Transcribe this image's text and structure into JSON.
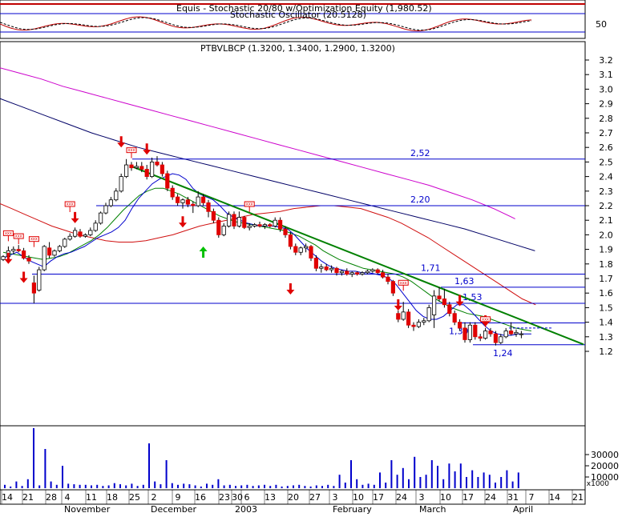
{
  "chart_data": {
    "type": "candlestick",
    "colors": {
      "up": "#ffffff",
      "down": "#e00000",
      "ma_short": "#0000cc",
      "ma_mid": "#008000",
      "ma_long_red": "#d01010",
      "ma_long_navy": "#000066",
      "ma_long_magenta": "#cc00cc",
      "trendline": "#008000",
      "level": "#0000cc",
      "volume": "#0000cc",
      "signal": "#e00000",
      "signal_up": "#00c000"
    },
    "indicator_panel": {
      "title": "Equis - Stochastic 20/80  w/Optimization Equity (1,980.52)",
      "subtitle": "Stochastic Oscillator (20.5128)",
      "ytick": "50"
    },
    "price_panel": {
      "title": "PTBVLBCP (1.3200, 1.3400, 1.2900, 1.3200)",
      "yticks": [
        "3.2",
        "3.1",
        "3.0",
        "2.9",
        "2.8",
        "2.7",
        "2.6",
        "2.5",
        "2.4",
        "2.3",
        "2.2",
        "2.1",
        "2.0",
        "1.9",
        "1.8",
        "1.7",
        "1.6",
        "1.5",
        "1.4",
        "1.3",
        "1.2"
      ],
      "levels": [
        {
          "label": "2,52",
          "value": 2.52
        },
        {
          "label": "2,20",
          "value": 2.2
        },
        {
          "label": "1,71",
          "value": 1.73
        },
        {
          "label": "1,63",
          "value": 1.64
        },
        {
          "label": "1,53",
          "value": 1.53
        },
        {
          "label": "1,39",
          "value": 1.395
        },
        {
          "label": "1,24",
          "value": 1.245
        }
      ],
      "candles": [
        {
          "o": 1.83,
          "h": 1.86,
          "l": 1.82,
          "c": 1.85
        },
        {
          "o": 1.85,
          "h": 1.92,
          "l": 1.84,
          "c": 1.89
        },
        {
          "o": 1.89,
          "h": 1.92,
          "l": 1.87,
          "c": 1.9
        },
        {
          "o": 1.9,
          "h": 1.93,
          "l": 1.88,
          "c": 1.89
        },
        {
          "o": 1.89,
          "h": 1.91,
          "l": 1.83,
          "c": 1.84
        },
        {
          "o": 1.84,
          "h": 1.86,
          "l": 1.8,
          "c": 1.82
        },
        {
          "o": 1.67,
          "h": 1.72,
          "l": 1.53,
          "c": 1.6
        },
        {
          "o": 1.62,
          "h": 1.78,
          "l": 1.61,
          "c": 1.76
        },
        {
          "o": 1.76,
          "h": 1.93,
          "l": 1.75,
          "c": 1.92
        },
        {
          "o": 1.91,
          "h": 1.95,
          "l": 1.84,
          "c": 1.86
        },
        {
          "o": 1.86,
          "h": 1.9,
          "l": 1.85,
          "c": 1.89
        },
        {
          "o": 1.89,
          "h": 1.93,
          "l": 1.88,
          "c": 1.92
        },
        {
          "o": 1.92,
          "h": 1.98,
          "l": 1.91,
          "c": 1.97
        },
        {
          "o": 1.97,
          "h": 2.01,
          "l": 1.96,
          "c": 1.99
        },
        {
          "o": 1.99,
          "h": 2.05,
          "l": 1.98,
          "c": 2.03
        },
        {
          "o": 2.02,
          "h": 2.04,
          "l": 1.98,
          "c": 1.99
        },
        {
          "o": 1.99,
          "h": 2.01,
          "l": 1.98,
          "c": 2.0
        },
        {
          "o": 2.0,
          "h": 2.05,
          "l": 1.99,
          "c": 2.03
        },
        {
          "o": 2.03,
          "h": 2.1,
          "l": 2.02,
          "c": 2.08
        },
        {
          "o": 2.08,
          "h": 2.16,
          "l": 2.07,
          "c": 2.15
        },
        {
          "o": 2.15,
          "h": 2.22,
          "l": 2.14,
          "c": 2.2
        },
        {
          "o": 2.2,
          "h": 2.26,
          "l": 2.19,
          "c": 2.24
        },
        {
          "o": 2.24,
          "h": 2.32,
          "l": 2.23,
          "c": 2.3
        },
        {
          "o": 2.3,
          "h": 2.42,
          "l": 2.29,
          "c": 2.4
        },
        {
          "o": 2.4,
          "h": 2.52,
          "l": 2.39,
          "c": 2.48
        },
        {
          "o": 2.48,
          "h": 2.5,
          "l": 2.44,
          "c": 2.46
        },
        {
          "o": 2.46,
          "h": 2.5,
          "l": 2.45,
          "c": 2.47
        },
        {
          "o": 2.47,
          "h": 2.5,
          "l": 2.43,
          "c": 2.45
        },
        {
          "o": 2.45,
          "h": 2.48,
          "l": 2.38,
          "c": 2.4
        },
        {
          "o": 2.4,
          "h": 2.53,
          "l": 2.39,
          "c": 2.5
        },
        {
          "o": 2.5,
          "h": 2.54,
          "l": 2.47,
          "c": 2.48
        },
        {
          "o": 2.48,
          "h": 2.5,
          "l": 2.4,
          "c": 2.42
        },
        {
          "o": 2.42,
          "h": 2.44,
          "l": 2.3,
          "c": 2.32
        },
        {
          "o": 2.32,
          "h": 2.34,
          "l": 2.24,
          "c": 2.26
        },
        {
          "o": 2.26,
          "h": 2.28,
          "l": 2.2,
          "c": 2.22
        },
        {
          "o": 2.22,
          "h": 2.25,
          "l": 2.18,
          "c": 2.24
        },
        {
          "o": 2.24,
          "h": 2.26,
          "l": 2.19,
          "c": 2.21
        },
        {
          "o": 2.21,
          "h": 2.23,
          "l": 2.15,
          "c": 2.2
        },
        {
          "o": 2.2,
          "h": 2.3,
          "l": 2.19,
          "c": 2.26
        },
        {
          "o": 2.26,
          "h": 2.28,
          "l": 2.2,
          "c": 2.22
        },
        {
          "o": 2.22,
          "h": 2.24,
          "l": 2.12,
          "c": 2.16
        },
        {
          "o": 2.16,
          "h": 2.18,
          "l": 2.08,
          "c": 2.1
        },
        {
          "o": 2.1,
          "h": 2.12,
          "l": 1.98,
          "c": 2.0
        },
        {
          "o": 2.0,
          "h": 2.08,
          "l": 1.99,
          "c": 2.06
        },
        {
          "o": 2.06,
          "h": 2.16,
          "l": 2.05,
          "c": 2.14
        },
        {
          "o": 2.14,
          "h": 2.16,
          "l": 2.04,
          "c": 2.06
        },
        {
          "o": 2.06,
          "h": 2.16,
          "l": 2.05,
          "c": 2.12
        },
        {
          "o": 2.12,
          "h": 2.13,
          "l": 2.04,
          "c": 2.05
        },
        {
          "o": 2.05,
          "h": 2.08,
          "l": 2.03,
          "c": 2.06
        },
        {
          "o": 2.06,
          "h": 2.08,
          "l": 2.05,
          "c": 2.07
        },
        {
          "o": 2.07,
          "h": 2.09,
          "l": 2.05,
          "c": 2.06
        },
        {
          "o": 2.06,
          "h": 2.08,
          "l": 2.04,
          "c": 2.07
        },
        {
          "o": 2.07,
          "h": 2.08,
          "l": 2.05,
          "c": 2.06
        },
        {
          "o": 2.06,
          "h": 2.12,
          "l": 2.05,
          "c": 2.1
        },
        {
          "o": 2.1,
          "h": 2.12,
          "l": 2.02,
          "c": 2.04
        },
        {
          "o": 2.04,
          "h": 2.06,
          "l": 1.98,
          "c": 2.0
        },
        {
          "o": 2.0,
          "h": 2.02,
          "l": 1.9,
          "c": 1.92
        },
        {
          "o": 1.92,
          "h": 1.94,
          "l": 1.86,
          "c": 1.88
        },
        {
          "o": 1.88,
          "h": 1.92,
          "l": 1.86,
          "c": 1.91
        },
        {
          "o": 1.91,
          "h": 1.94,
          "l": 1.88,
          "c": 1.92
        },
        {
          "o": 1.92,
          "h": 1.93,
          "l": 1.82,
          "c": 1.84
        },
        {
          "o": 1.84,
          "h": 1.86,
          "l": 1.75,
          "c": 1.77
        },
        {
          "o": 1.77,
          "h": 1.8,
          "l": 1.74,
          "c": 1.78
        },
        {
          "o": 1.78,
          "h": 1.8,
          "l": 1.75,
          "c": 1.76
        },
        {
          "o": 1.76,
          "h": 1.79,
          "l": 1.74,
          "c": 1.77
        },
        {
          "o": 1.77,
          "h": 1.78,
          "l": 1.72,
          "c": 1.74
        },
        {
          "o": 1.74,
          "h": 1.76,
          "l": 1.72,
          "c": 1.75
        },
        {
          "o": 1.75,
          "h": 1.77,
          "l": 1.72,
          "c": 1.73
        },
        {
          "o": 1.73,
          "h": 1.75,
          "l": 1.71,
          "c": 1.74
        },
        {
          "o": 1.74,
          "h": 1.75,
          "l": 1.72,
          "c": 1.73
        },
        {
          "o": 1.73,
          "h": 1.75,
          "l": 1.72,
          "c": 1.74
        },
        {
          "o": 1.74,
          "h": 1.76,
          "l": 1.73,
          "c": 1.75
        },
        {
          "o": 1.75,
          "h": 1.77,
          "l": 1.74,
          "c": 1.76
        },
        {
          "o": 1.76,
          "h": 1.77,
          "l": 1.73,
          "c": 1.74
        },
        {
          "o": 1.74,
          "h": 1.76,
          "l": 1.7,
          "c": 1.71
        },
        {
          "o": 1.71,
          "h": 1.73,
          "l": 1.66,
          "c": 1.68
        },
        {
          "o": 1.68,
          "h": 1.69,
          "l": 1.58,
          "c": 1.6
        },
        {
          "o": 1.46,
          "h": 1.48,
          "l": 1.4,
          "c": 1.42
        },
        {
          "o": 1.42,
          "h": 1.54,
          "l": 1.41,
          "c": 1.47
        },
        {
          "o": 1.47,
          "h": 1.49,
          "l": 1.36,
          "c": 1.38
        },
        {
          "o": 1.38,
          "h": 1.4,
          "l": 1.34,
          "c": 1.37
        },
        {
          "o": 1.37,
          "h": 1.42,
          "l": 1.36,
          "c": 1.4
        },
        {
          "o": 1.4,
          "h": 1.43,
          "l": 1.38,
          "c": 1.41
        },
        {
          "o": 1.41,
          "h": 1.52,
          "l": 1.4,
          "c": 1.5
        },
        {
          "o": 1.45,
          "h": 1.62,
          "l": 1.36,
          "c": 1.58
        },
        {
          "o": 1.58,
          "h": 1.64,
          "l": 1.54,
          "c": 1.56
        },
        {
          "o": 1.56,
          "h": 1.63,
          "l": 1.5,
          "c": 1.52
        },
        {
          "o": 1.52,
          "h": 1.54,
          "l": 1.44,
          "c": 1.46
        },
        {
          "o": 1.46,
          "h": 1.48,
          "l": 1.38,
          "c": 1.4
        },
        {
          "o": 1.4,
          "h": 1.42,
          "l": 1.34,
          "c": 1.36
        },
        {
          "o": 1.36,
          "h": 1.4,
          "l": 1.26,
          "c": 1.28
        },
        {
          "o": 1.28,
          "h": 1.4,
          "l": 1.26,
          "c": 1.38
        },
        {
          "o": 1.38,
          "h": 1.4,
          "l": 1.28,
          "c": 1.3
        },
        {
          "o": 1.3,
          "h": 1.32,
          "l": 1.27,
          "c": 1.29
        },
        {
          "o": 1.29,
          "h": 1.36,
          "l": 1.28,
          "c": 1.34
        },
        {
          "o": 1.34,
          "h": 1.36,
          "l": 1.3,
          "c": 1.32
        },
        {
          "o": 1.32,
          "h": 1.34,
          "l": 1.24,
          "c": 1.26
        },
        {
          "o": 1.26,
          "h": 1.32,
          "l": 1.25,
          "c": 1.3
        },
        {
          "o": 1.3,
          "h": 1.36,
          "l": 1.29,
          "c": 1.34
        },
        {
          "o": 1.34,
          "h": 1.4,
          "l": 1.31,
          "c": 1.32
        },
        {
          "o": 1.32,
          "h": 1.35,
          "l": 1.3,
          "c": 1.33
        },
        {
          "o": 1.32,
          "h": 1.34,
          "l": 1.29,
          "c": 1.32
        }
      ],
      "ma_short_values": [
        1.84,
        1.86,
        1.88,
        1.85,
        1.82,
        1.8,
        1.78,
        1.82,
        1.85,
        1.87,
        1.88,
        1.9,
        1.92,
        1.95,
        1.98,
        2.0,
        2.02,
        2.05,
        2.1,
        2.18,
        2.25,
        2.3,
        2.35,
        2.38,
        2.4,
        2.42,
        2.41,
        2.38,
        2.32,
        2.28,
        2.26,
        2.24,
        2.2,
        2.15,
        2.12,
        2.1,
        2.08,
        2.07,
        2.06,
        2.06,
        2.06,
        2.05,
        2.04,
        2.0,
        1.95,
        1.9,
        1.86,
        1.82,
        1.79,
        1.77,
        1.76,
        1.75,
        1.75,
        1.74,
        1.74,
        1.73,
        1.72,
        1.7,
        1.66,
        1.6,
        1.54,
        1.48,
        1.44,
        1.42,
        1.42,
        1.44,
        1.48,
        1.52,
        1.52,
        1.48,
        1.43,
        1.38,
        1.34,
        1.32,
        1.31,
        1.31,
        1.32,
        1.32,
        1.32
      ],
      "ma_mid_values": [
        1.88,
        1.87,
        1.86,
        1.85,
        1.84,
        1.83,
        1.84,
        1.85,
        1.87,
        1.9,
        1.93,
        1.96,
        2.0,
        2.05,
        2.11,
        2.17,
        2.22,
        2.27,
        2.3,
        2.32,
        2.32,
        2.3,
        2.28,
        2.25,
        2.22,
        2.19,
        2.16,
        2.13,
        2.11,
        2.09,
        2.08,
        2.07,
        2.06,
        2.05,
        2.04,
        2.03,
        2.01,
        1.99,
        1.96,
        1.93,
        1.89,
        1.86,
        1.83,
        1.81,
        1.79,
        1.77,
        1.76,
        1.75,
        1.74,
        1.73,
        1.71,
        1.68,
        1.64,
        1.6,
        1.56,
        1.53,
        1.5,
        1.48,
        1.46,
        1.45,
        1.44,
        1.42,
        1.4,
        1.38,
        1.36,
        1.35,
        1.34
      ],
      "ma_long_red_values": [
        2.22,
        2.18,
        2.14,
        2.1,
        2.06,
        2.03,
        2.0,
        1.98,
        1.96,
        1.95,
        1.95,
        1.96,
        1.98,
        2.0,
        2.03,
        2.06,
        2.08,
        2.1,
        2.12,
        2.14,
        2.15,
        2.16,
        2.18,
        2.19,
        2.2,
        2.2,
        2.19,
        2.18,
        2.15,
        2.12,
        2.08,
        2.03,
        1.98,
        1.92,
        1.86,
        1.8,
        1.74,
        1.68,
        1.62,
        1.56,
        1.52
      ],
      "ma_long_navy_values": [
        2.94,
        2.88,
        2.82,
        2.76,
        2.7,
        2.65,
        2.6,
        2.56,
        2.52,
        2.48,
        2.44,
        2.4,
        2.36,
        2.32,
        2.28,
        2.24,
        2.2,
        2.16,
        2.12,
        2.08,
        2.04,
        1.99,
        1.94,
        1.89
      ],
      "ma_long_magenta_values": [
        3.15,
        3.11,
        3.07,
        3.02,
        2.98,
        2.94,
        2.9,
        2.86,
        2.82,
        2.78,
        2.74,
        2.7,
        2.66,
        2.62,
        2.58,
        2.54,
        2.5,
        2.46,
        2.42,
        2.38,
        2.34,
        2.29,
        2.24,
        2.18,
        2.11
      ],
      "trendline": [
        {
          "bar": 25,
          "value": 2.47
        },
        {
          "bar": 103,
          "value": 1.27
        }
      ],
      "resistance_line": {
        "value": 1.36,
        "bar_start": 90,
        "bar_end": 110
      },
      "sell_markers": [
        {
          "bar": 1,
          "value": 1.8
        },
        {
          "bar": 4,
          "value": 1.67
        },
        {
          "bar": 14,
          "value": 2.08
        },
        {
          "bar": 23,
          "value": 2.6
        },
        {
          "bar": 28,
          "value": 2.55
        },
        {
          "bar": 35,
          "value": 2.05
        },
        {
          "bar": 56,
          "value": 1.59
        },
        {
          "bar": 77,
          "value": 1.48
        },
        {
          "bar": 89,
          "value": 1.51
        },
        {
          "bar": 94,
          "value": 1.37
        }
      ],
      "buy_markers": [
        {
          "bar": 39,
          "value": 1.92
        }
      ],
      "signal_tag_label": "xxx",
      "signal_tags": [
        {
          "bar": 1,
          "value": 2.0
        },
        {
          "bar": 3,
          "value": 1.98
        },
        {
          "bar": 6,
          "value": 1.96
        },
        {
          "bar": 13,
          "value": 2.2
        },
        {
          "bar": 25,
          "value": 2.57
        },
        {
          "bar": 48,
          "value": 2.2
        },
        {
          "bar": 78,
          "value": 1.66
        },
        {
          "bar": 94,
          "value": 1.41
        }
      ]
    },
    "volume_panel": {
      "yticks": [
        "30000",
        "20000",
        "10000"
      ],
      "unit_label": "x1000",
      "values": [
        3000,
        1500,
        6000,
        2000,
        8000,
        60000,
        2500,
        35000,
        6000,
        3000,
        20000,
        4000,
        3500,
        3000,
        3000,
        2500,
        3000,
        2000,
        2500,
        4500,
        3500,
        2500,
        4000,
        2000,
        3000,
        40000,
        6000,
        3500,
        25000,
        4500,
        3000,
        4000,
        3500,
        2500,
        1500,
        4000,
        3000,
        8000,
        2500,
        3000,
        2000,
        2500,
        3000,
        2000,
        2500,
        3000,
        2000,
        3000,
        1500,
        2000,
        2500,
        3000,
        2000,
        1500,
        2500,
        2000,
        3000,
        2000,
        12000,
        5000,
        25000,
        8000,
        3000,
        4000,
        3000,
        14000,
        5000,
        25000,
        12000,
        18000,
        8000,
        28000,
        10000,
        12000,
        25000,
        20000,
        8000,
        22000,
        15000,
        22000,
        10000,
        16000,
        10000,
        14000,
        12000,
        5000,
        10000,
        16000,
        6000,
        14000
      ]
    },
    "x_axis": {
      "ticks": [
        "14",
        "21",
        "28",
        "4",
        "11",
        "18",
        "25",
        "2",
        "9",
        "16",
        "23",
        "30",
        "6",
        "13",
        "20",
        "27",
        "3",
        "10",
        "17",
        "24",
        "3",
        "10",
        "17",
        "24",
        "31",
        "7",
        "14",
        "21"
      ],
      "months": [
        "November",
        "December",
        "2003",
        "February",
        "March",
        "April"
      ]
    }
  }
}
